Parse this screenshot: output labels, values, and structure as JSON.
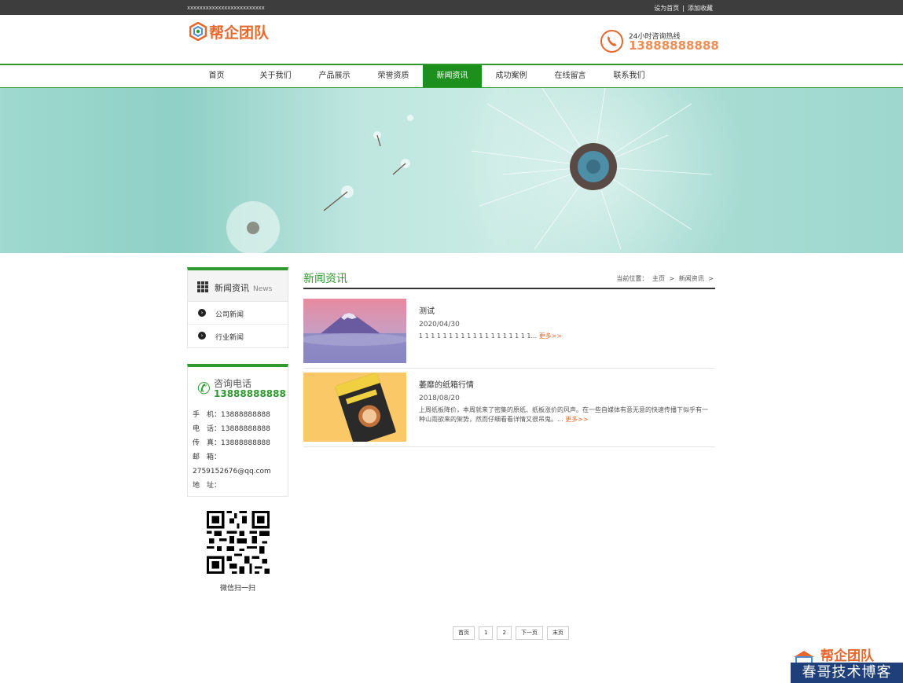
{
  "topbar": {
    "slogan": "xxxxxxxxxxxxxxxxxxxxxxxxx",
    "set_home": "设为首页",
    "separator": "|",
    "add_favorite": "添加收藏"
  },
  "header": {
    "logo_text": "帮企团队",
    "hotline_label": "24小时咨询热线",
    "hotline_number": "13888888888"
  },
  "nav": {
    "items": [
      {
        "label": "首页"
      },
      {
        "label": "关于我们"
      },
      {
        "label": "产品展示"
      },
      {
        "label": "荣誉资质"
      },
      {
        "label": "新闻资讯"
      },
      {
        "label": "成功案例"
      },
      {
        "label": "在线留言"
      },
      {
        "label": "联系我们"
      }
    ],
    "active_index": 4
  },
  "sidebar": {
    "title": "新闻资讯",
    "title_en": "News",
    "categories": [
      {
        "label": "公司新闻"
      },
      {
        "label": "行业新闻"
      }
    ],
    "contact": {
      "title": "咨询电话",
      "phone": "13888888888",
      "mobile_label": "手　机：",
      "mobile": "13888888888",
      "tel_label": "电　话：",
      "tel": "13888888888",
      "fax_label": "传　真：",
      "fax": "13888888888",
      "email_label": "邮　箱：",
      "email": "2759152676@qq.com",
      "address_label": "地　址："
    },
    "qr_caption": "微信扫一扫"
  },
  "main": {
    "title": "新闻资讯",
    "breadcrumb_label": "当前位置：",
    "breadcrumb_home": "主页",
    "breadcrumb_sep": ">",
    "breadcrumb_current": "新闻资讯",
    "news": [
      {
        "title": "测试",
        "date": "2020/04/30",
        "summary": "1 1 1 1 1 1 1 1 1 1 1 1 1 1 1 1 1 1 1...",
        "more": "更多>>"
      },
      {
        "title": "萎靡的纸箱行情",
        "date": "2018/08/20",
        "summary": "上周纸板降价，本周就来了密集的原纸、纸板涨价的风声。在一些自媒体有意无意的快速传播下似乎有一种山雨欲来的架势，然而仔细看看详情又很吊鬼。...",
        "more": "更多>>"
      }
    ]
  },
  "pagination": {
    "first": "首页",
    "pages": [
      "1",
      "2"
    ],
    "next": "下一页",
    "last": "末页"
  },
  "watermark": {
    "logo": "帮企团队",
    "text": "春哥技术博客"
  },
  "colors": {
    "brand_green": "#2e9a2e",
    "nav_active": "#1d8f1d",
    "accent_orange": "#e8672c",
    "topbar_bg": "#3d3d3d"
  }
}
